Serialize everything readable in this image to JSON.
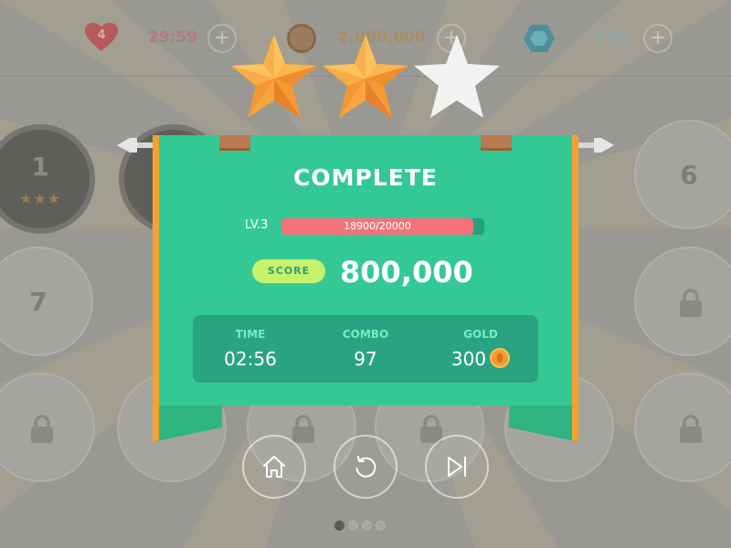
{
  "hud": {
    "lives": "4",
    "timer": "29:59",
    "coins": "2,000,000",
    "gems": "500",
    "plus_symbol": "+",
    "icons": [
      "heart-icon",
      "coin-icon",
      "gem-icon"
    ]
  },
  "levels": [
    {
      "number": "1",
      "stars": "★★★"
    },
    {
      "number": "6"
    },
    {
      "number": "7"
    }
  ],
  "result": {
    "stars_earned": 2,
    "stars_total": 3,
    "title": "COMPLETE",
    "level_label": "LV.3",
    "xp_text": "18900/20000",
    "xp_progress": 0.945,
    "score_label": "SCORE",
    "score_value": "800,000",
    "stats": {
      "time_label": "TIME",
      "time_value": "02:56",
      "combo_label": "COMBO",
      "combo_value": "97",
      "gold_label": "GOLD",
      "gold_value": "300"
    }
  },
  "buttons": [
    "home-icon",
    "replay-icon",
    "next-icon"
  ],
  "pagination": {
    "count": 4,
    "active": 0
  },
  "colors": {
    "banner": "#34c994",
    "banner_edge": "#f3a230",
    "xp_fill": "#f2747a",
    "score_pill": "#c6f26b",
    "star_gold": "#f7a23a",
    "star_empty": "#f2f2f2"
  }
}
